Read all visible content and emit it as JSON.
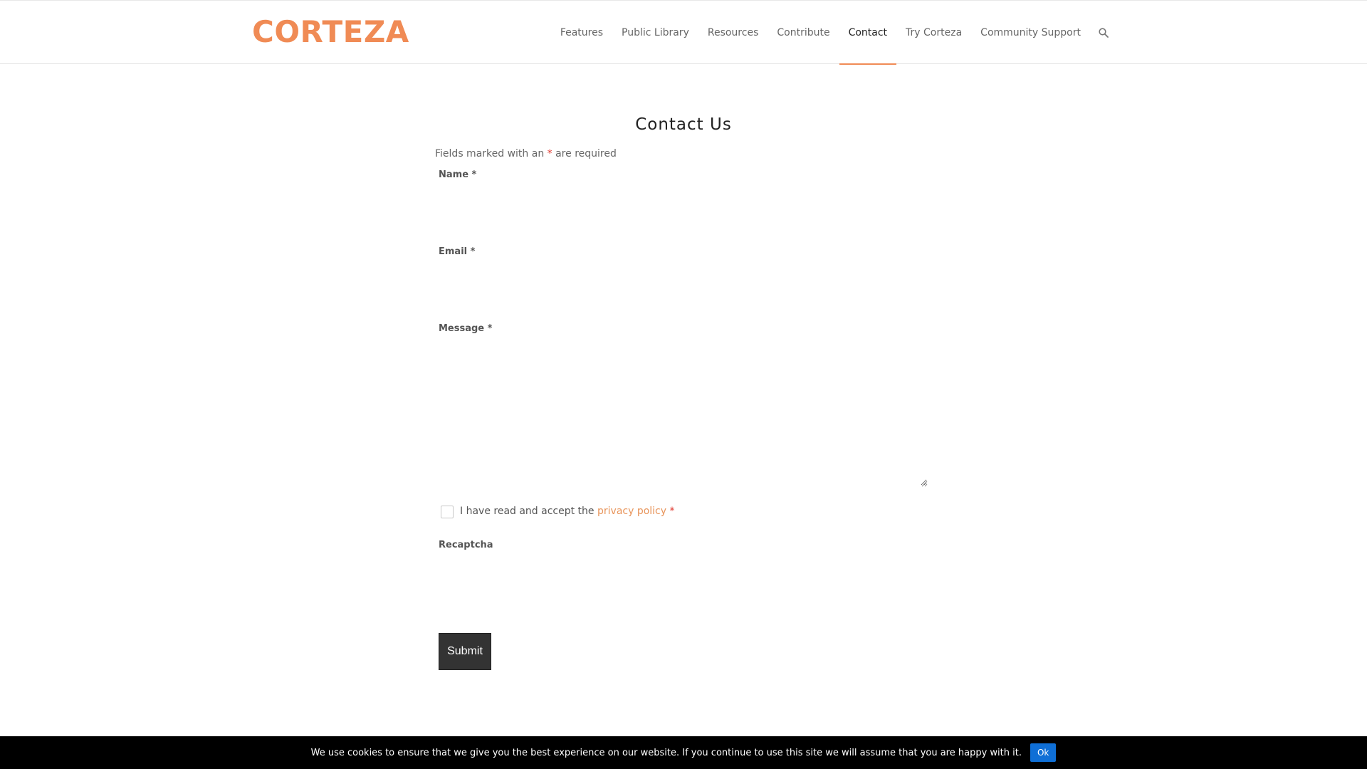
{
  "header": {
    "logo": "CORTEZA",
    "nav": [
      {
        "label": "Features"
      },
      {
        "label": "Public Library"
      },
      {
        "label": "Resources"
      },
      {
        "label": "Contribute"
      },
      {
        "label": "Contact",
        "active": true
      },
      {
        "label": "Try Corteza"
      },
      {
        "label": "Community Support"
      }
    ],
    "search_icon": "search-icon"
  },
  "form": {
    "title": "Contact Us",
    "required_note_prefix": "Fields marked with an ",
    "required_note_asterisk": "*",
    "required_note_suffix": " are required",
    "name_label": "Name *",
    "name_value": "",
    "email_label": "Email *",
    "email_value": "",
    "message_label": "Message *",
    "message_value": "",
    "consent_prefix": "I have read and accept the ",
    "consent_link": "privacy policy",
    "consent_suffix": " *",
    "consent_checked": false,
    "recaptcha_label": "Recaptcha",
    "submit_label": "Submit"
  },
  "cookie_bar": {
    "text": "We use cookies to ensure that we give you the best experience on our website. If you continue to use this site we will assume that you are happy with it.",
    "ok_label": "Ok"
  },
  "colors": {
    "brand": "#f08b55",
    "required": "#e0352b",
    "cookie_button": "#0f6fd6"
  }
}
